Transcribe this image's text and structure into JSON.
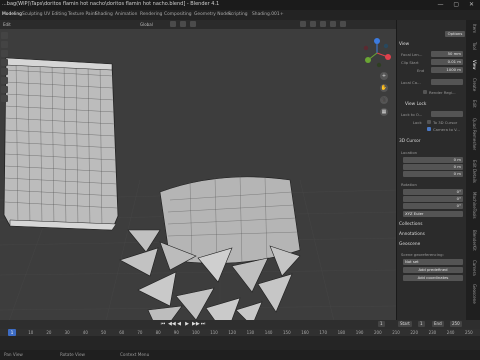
{
  "window": {
    "title": "...bag(WIP)\\Taps\\doritos flamin hot nacho\\doritos flamin hot nacho.blend] - Blender 4.1",
    "controls": "— ▢ ✕"
  },
  "workspace_tabs": [
    "Modeling",
    "Sculpting",
    "UV Editing",
    "Texture Paint",
    "Shading",
    "Animation",
    "Rendering",
    "Compositing",
    "Geometry Nodes",
    "Scripting",
    "Shading.001",
    "+"
  ],
  "active_tab": "Modeling",
  "viewport_header": {
    "left_label": "Edit",
    "orientation": "Global"
  },
  "nav_buttons": [
    "+",
    "✋",
    "🎥",
    "▦"
  ],
  "sidebar": {
    "options_label": "Options",
    "view_section": "View",
    "focal_length": {
      "label": "Focal Len...",
      "value": "50 mm"
    },
    "clip_start": {
      "label": "Clip Start",
      "value": "0.01 m"
    },
    "clip_end": {
      "label": "End",
      "value": "1000 m"
    },
    "local_camera": {
      "label": "Local Ca..."
    },
    "render_region": "Render Regi...",
    "view_lock_section": "View Lock",
    "lock_to_object": "Lock to O...",
    "lock_label": "Lock",
    "to_3d_cursor": "To 3D Cursor",
    "camera_to_view": "Camera to V...",
    "cursor_section": "3D Cursor",
    "location_label": "Location",
    "loc_x": {
      "label": "X",
      "value": "0 m"
    },
    "loc_y": {
      "label": "Y",
      "value": "0 m"
    },
    "loc_z": {
      "label": "Z",
      "value": "0 m"
    },
    "rotation_label": "Rotation",
    "rot_x": {
      "label": "X",
      "value": "0°"
    },
    "rot_y": {
      "label": "Y",
      "value": "0°"
    },
    "rot_z": {
      "label": "Z",
      "value": "0°"
    },
    "rotation_mode": "XYZ Euler",
    "collections": "Collections",
    "annotations": "Annotations",
    "geoscene": "Geoscene",
    "georef_label": "Scene georeferencing:",
    "georef_mode": "Not set",
    "add_predef_crs": "Add predefined",
    "add_coords": "Add coordinates"
  },
  "n_tabs": [
    "Item",
    "Tool",
    "View",
    "Create",
    "Edit",
    "Quad Remesher",
    "Edit Details",
    "MachineTools",
    "BlenderKit",
    "Camera",
    "Geoscene"
  ],
  "active_n_tab": "View",
  "timeline": {
    "playback": [
      "⏮",
      "◀◀",
      "◀",
      "▶",
      "▶▶",
      "⏭"
    ],
    "current_frame": "1",
    "start_label": "Start",
    "start_value": "1",
    "end_label": "End",
    "end_value": "250",
    "ruler": [
      "1",
      "10",
      "20",
      "30",
      "40",
      "50",
      "60",
      "70",
      "80",
      "90",
      "100",
      "110",
      "120",
      "130",
      "140",
      "150",
      "160",
      "170",
      "180",
      "190",
      "200",
      "210",
      "220",
      "230",
      "240",
      "250"
    ]
  },
  "status_bar": {
    "pan": "Pan View",
    "rotate": "Rotate View",
    "context": "Context Menu"
  }
}
